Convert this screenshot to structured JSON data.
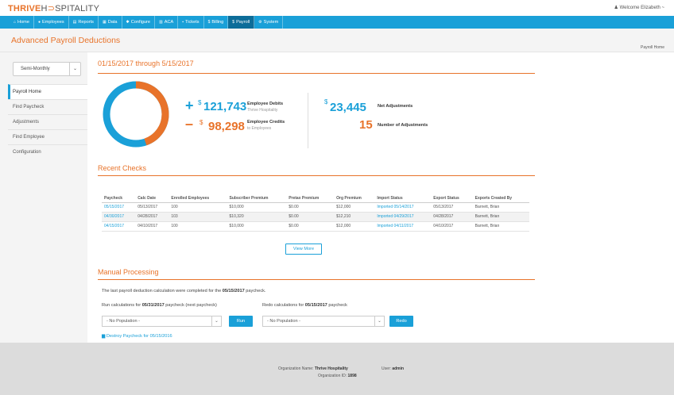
{
  "brand": {
    "logo_part1": "THRIVE",
    "logo_part2": "H",
    "logo_part3": "SPITALITY",
    "welcome": "Welcome Elizabeth ~"
  },
  "nav": [
    {
      "icon": "home-icon",
      "glyph": "⌂",
      "label": "Home",
      "active": false
    },
    {
      "icon": "users-icon",
      "glyph": "●",
      "label": "Employees",
      "active": false
    },
    {
      "icon": "chart-icon",
      "glyph": "▤",
      "label": "Reports",
      "active": false
    },
    {
      "icon": "data-icon",
      "glyph": "▦",
      "label": "Data",
      "active": false
    },
    {
      "icon": "cogs-icon",
      "glyph": "✱",
      "label": "Configure",
      "active": false
    },
    {
      "icon": "aca-icon",
      "glyph": "▥",
      "label": "ACA",
      "active": false
    },
    {
      "icon": "ticket-icon",
      "glyph": "▪",
      "label": "Tickets",
      "active": false
    },
    {
      "icon": "dollar-icon",
      "glyph": "$",
      "label": "Billing",
      "active": false
    },
    {
      "icon": "dollar-icon",
      "glyph": "$",
      "label": "Payroll",
      "active": true
    },
    {
      "icon": "gear-icon",
      "glyph": "⚙",
      "label": "System",
      "active": false
    }
  ],
  "page": {
    "title": "Advanced Payroll Deductions",
    "breadcrumb": "Payroll Home"
  },
  "sidebar": {
    "period": "Semi-Monthly",
    "items": [
      {
        "label": "Payroll Home",
        "active": true
      },
      {
        "label": "Find Paycheck",
        "active": false
      },
      {
        "label": "Adjustments",
        "active": false
      },
      {
        "label": "Find Employee",
        "active": false
      },
      {
        "label": "Configuration",
        "active": false
      }
    ]
  },
  "summary": {
    "range": "01/15/2017 through 5/15/2017",
    "donut": {
      "debit_fraction": 0.553,
      "credit_fraction": 0.447,
      "debit_color": "#1aa0d8",
      "credit_color": "#e8732a"
    },
    "debits": {
      "sign": "+",
      "currency": "$",
      "amount": "121,743",
      "label": "Employee Debits",
      "sub": "Thrive Hospitality"
    },
    "credits": {
      "sign": "–",
      "currency": "$",
      "amount": "98,298",
      "label": "Employee Credits",
      "sub": "to Employees"
    },
    "net": {
      "currency": "$",
      "amount": "23,445",
      "label": "Net Adjustments"
    },
    "count": {
      "amount": "15",
      "label": "Number of Adjustments"
    }
  },
  "recent": {
    "title": "Recent Checks",
    "headers": [
      "Paycheck",
      "Calc Date",
      "Enrolled Employees",
      "Subscriber Premium",
      "Pretax Premium",
      "Org Premium",
      "Import Status",
      "Export Status",
      "Exports Created By"
    ],
    "rows": [
      [
        "05/15/2017",
        "05/13/2017",
        "100",
        "$10,000",
        "$0.00",
        "$12,000",
        "Imported 05/14/2017",
        "05/13/2017",
        "Barnett, Brian"
      ],
      [
        "04/30/2017",
        "04/28/2017",
        "103",
        "$10,320",
        "$0.00",
        "$12,210",
        "Imported 04/29/2017",
        "04/28/2017",
        "Barnett, Brian"
      ],
      [
        "04/15/2017",
        "04/10/2017",
        "100",
        "$10,000",
        "$0.00",
        "$12,000",
        "Imported 04/11/2017",
        "04/10/2017",
        "Barnett, Brian"
      ]
    ],
    "view_more": "View More"
  },
  "manual": {
    "title": "Manual Processing",
    "note_pre": "The last payroll deduction calculation were completed for the ",
    "note_date": "05/15/2017",
    "note_post": " paycheck.",
    "run_pre": "Run calculations for ",
    "run_date": "05/31/2017",
    "run_post": " paycheck (next paycheck)",
    "redo_pre": "Redo calculations for ",
    "redo_date": "05/15/2017",
    "redo_post": " paycheck",
    "run_select": "- No Population -",
    "redo_select": "- No Population -",
    "run_button": "Run",
    "redo_button": "Redo",
    "destroy": "Destroy Paycheck for 05/15/2016"
  },
  "footer": {
    "org_label": "Organization Name:",
    "org_name": "Thrive Hospitality",
    "user_label": "User:",
    "user_name": "admin",
    "org_id_label": "Organization ID:",
    "org_id": "1898"
  }
}
